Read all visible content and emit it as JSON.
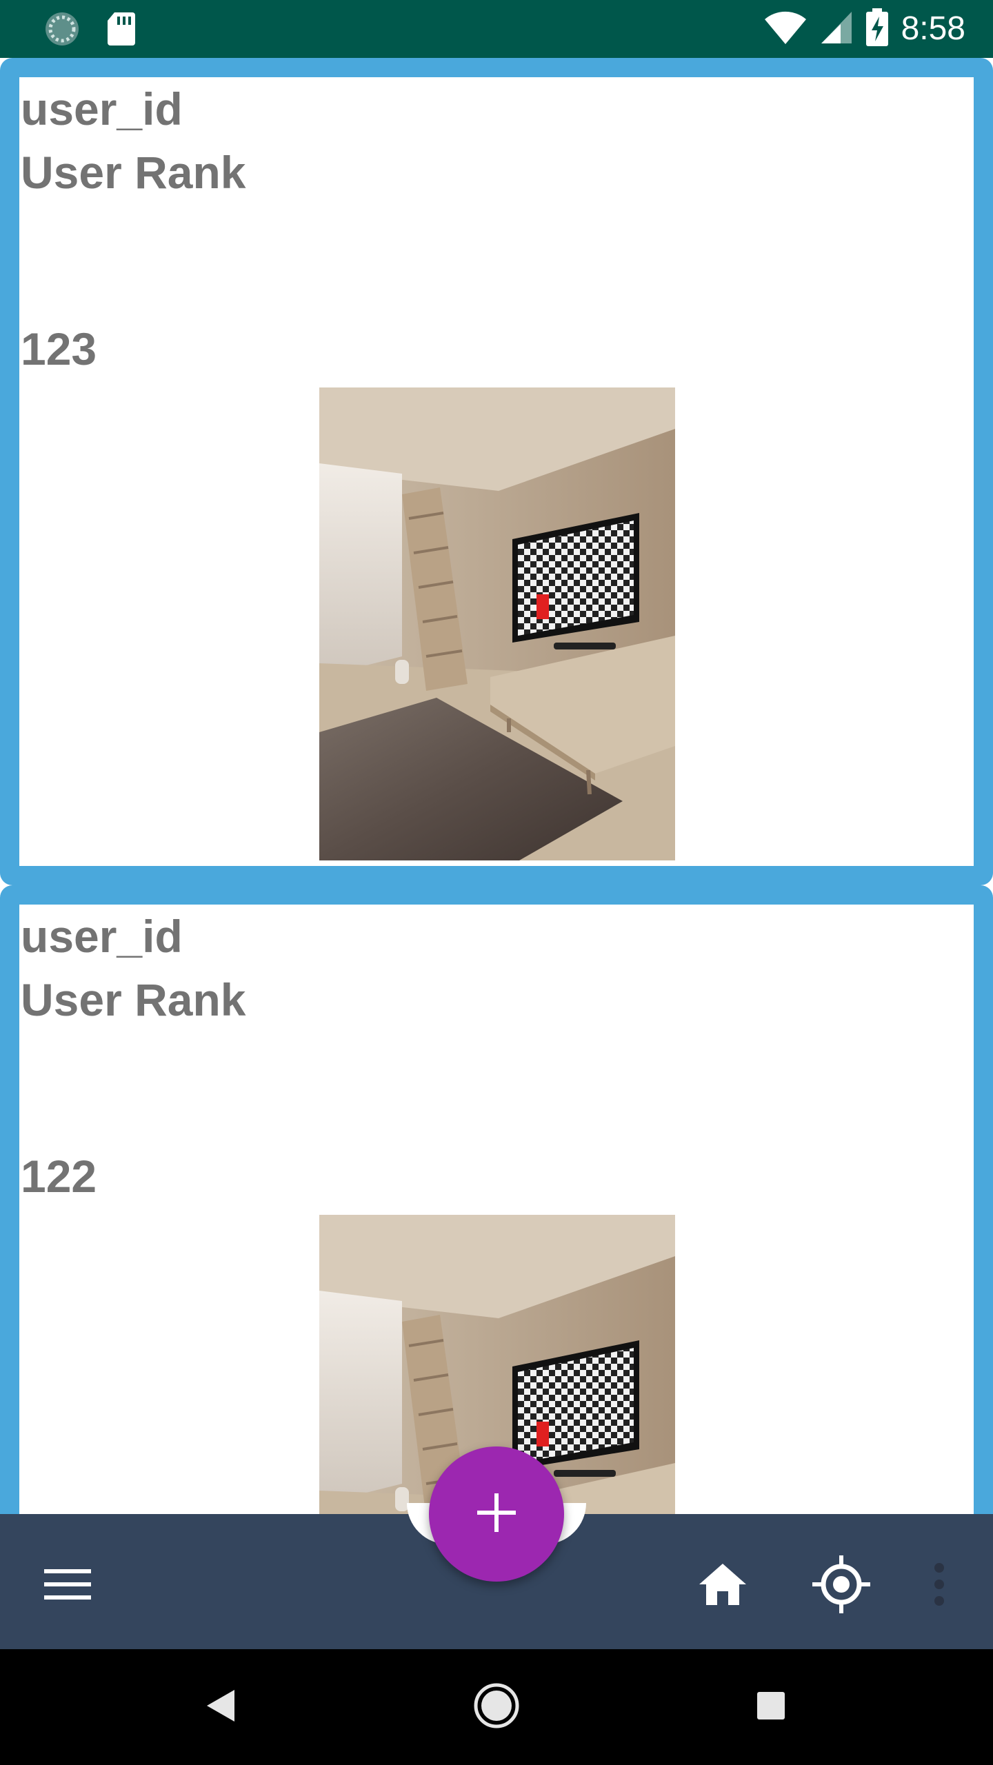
{
  "status_bar": {
    "time": "8:58",
    "icons": [
      "sync-icon",
      "sd-card-icon",
      "wifi-icon",
      "signal-icon",
      "battery-charging-icon"
    ]
  },
  "feed": {
    "posts": [
      {
        "user_id": "user_id",
        "user_rank": "User Rank",
        "number": "123",
        "image": "room-photo-with-tv"
      },
      {
        "user_id": "user_id",
        "user_rank": "User Rank",
        "number": "122",
        "image": "room-photo-with-tv"
      }
    ]
  },
  "bottom_bar": {
    "icons": [
      "menu-icon",
      "home-icon",
      "my-location-icon",
      "more-vert-icon"
    ],
    "fab_icon": "add-icon"
  },
  "nav_bar": {
    "icons": [
      "back-icon",
      "home-circle-icon",
      "recents-icon"
    ]
  },
  "colors": {
    "status_bar": "#00574b",
    "card_border": "#4aa8dc",
    "bottom_bar": "#34455d",
    "fab": "#9c27b0",
    "text_gray": "#737373"
  }
}
